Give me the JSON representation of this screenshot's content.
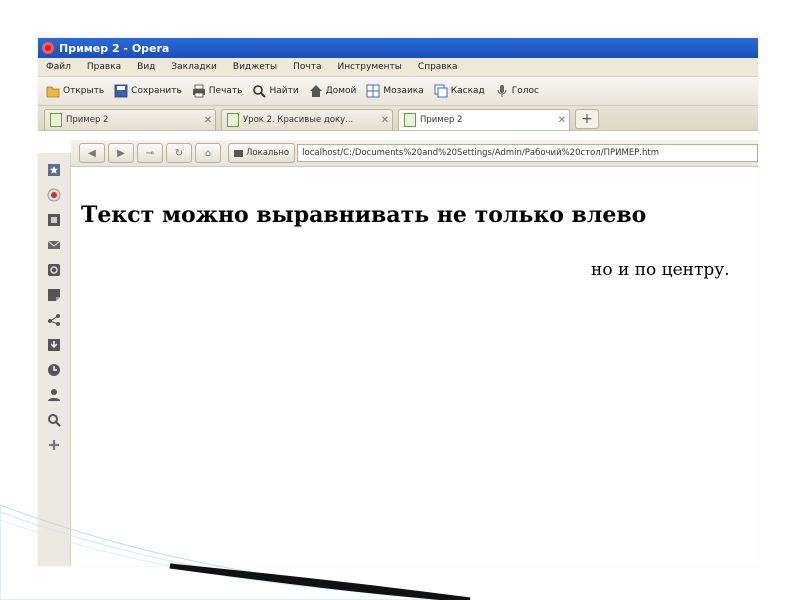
{
  "window": {
    "title": "Пример 2 - Opera"
  },
  "menu": [
    "Файл",
    "Правка",
    "Вид",
    "Закладки",
    "Виджеты",
    "Почта",
    "Инструменты",
    "Справка"
  ],
  "toolbar": [
    {
      "label": "Открыть",
      "icon": "folder-icon"
    },
    {
      "label": "Сохранить",
      "icon": "save-icon"
    },
    {
      "label": "Печать",
      "icon": "print-icon"
    },
    {
      "label": "Найти",
      "icon": "search-icon"
    },
    {
      "label": "Домой",
      "icon": "home-icon"
    },
    {
      "label": "Мозаика",
      "icon": "tile-icon"
    },
    {
      "label": "Каскад",
      "icon": "cascade-icon"
    },
    {
      "label": "Голос",
      "icon": "microphone-icon"
    }
  ],
  "tabs": [
    {
      "label": "Пример 2",
      "active": false
    },
    {
      "label": "Урок 2. Красивые доку...",
      "active": false
    },
    {
      "label": "Пример 2",
      "active": true
    }
  ],
  "address": {
    "badge": "Локально",
    "url": "localhost/C:/Documents%20and%20Settings/Admin/Рабочий%20стол/ПРИМЕР.htm"
  },
  "page": {
    "heading": "Текст можно выравнивать не только влево",
    "centered": "но и по центру."
  },
  "panel_icons": [
    "bookmarks-icon",
    "widgets-icon",
    "notes-icon",
    "mail-icon",
    "settings-icon",
    "notes-panel-icon",
    "links-icon",
    "downloads-icon",
    "history-icon",
    "contacts-icon",
    "search-icon",
    "add-panel-icon"
  ]
}
